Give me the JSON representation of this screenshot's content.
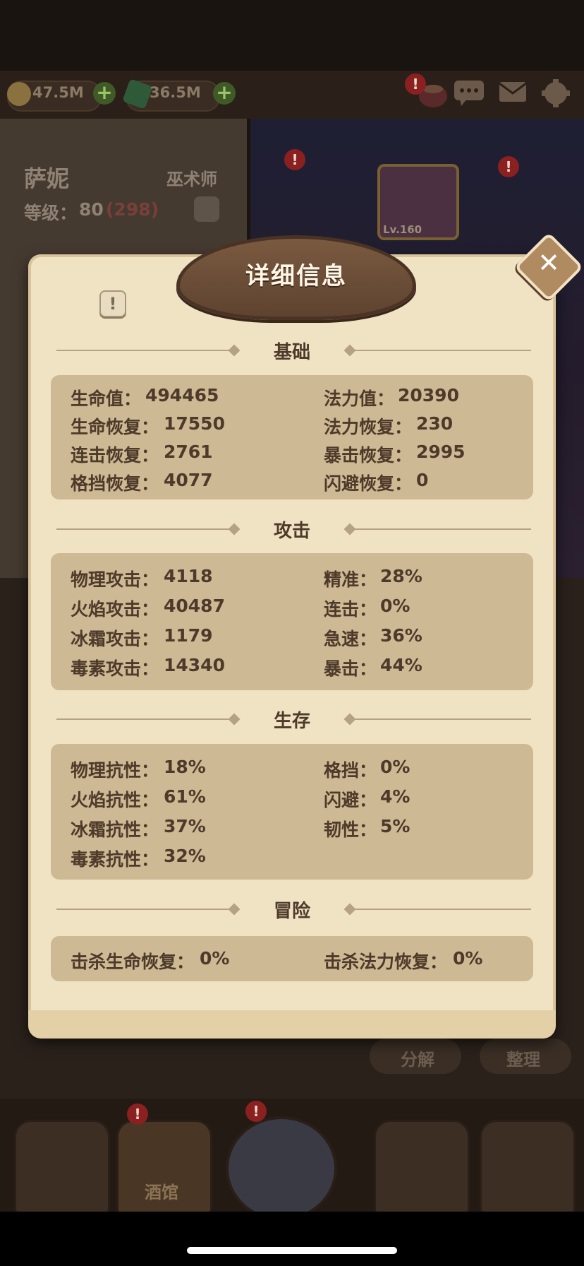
{
  "header": {
    "gold": "47.5M",
    "gems": "36.5M"
  },
  "hero": {
    "name": "萨妮",
    "class": "巫术师",
    "level_label": "等级：",
    "level": "80",
    "level_extra": "(298)",
    "portrait_level": "Lv.160"
  },
  "modal": {
    "title": "详细信息",
    "sections": [
      {
        "title": "基础",
        "stats": [
          {
            "label": "生命值：",
            "value": "494465"
          },
          {
            "label": "法力值：",
            "value": "20390"
          },
          {
            "label": "生命恢复：",
            "value": "17550"
          },
          {
            "label": "法力恢复：",
            "value": "230"
          },
          {
            "label": "连击恢复：",
            "value": "2761"
          },
          {
            "label": "暴击恢复：",
            "value": "2995"
          },
          {
            "label": "格挡恢复：",
            "value": "4077"
          },
          {
            "label": "闪避恢复：",
            "value": "0"
          }
        ]
      },
      {
        "title": "攻击",
        "stats": [
          {
            "label": "物理攻击：",
            "value": "4118"
          },
          {
            "label": "精准：",
            "value": "28%"
          },
          {
            "label": "火焰攻击：",
            "value": "40487"
          },
          {
            "label": "连击：",
            "value": "0%"
          },
          {
            "label": "冰霜攻击：",
            "value": "1179"
          },
          {
            "label": "急速：",
            "value": "36%"
          },
          {
            "label": "毒素攻击：",
            "value": "14340"
          },
          {
            "label": "暴击：",
            "value": "44%"
          }
        ]
      },
      {
        "title": "生存",
        "stats": [
          {
            "label": "物理抗性：",
            "value": "18%"
          },
          {
            "label": "格挡：",
            "value": "0%"
          },
          {
            "label": "火焰抗性：",
            "value": "61%"
          },
          {
            "label": "闪避：",
            "value": "4%"
          },
          {
            "label": "冰霜抗性：",
            "value": "37%"
          },
          {
            "label": "韧性：",
            "value": "5%"
          },
          {
            "label": "毒素抗性：",
            "value": "32%"
          }
        ]
      },
      {
        "title": "冒险",
        "stats": [
          {
            "label": "击杀生命恢复：",
            "value": "0%"
          },
          {
            "label": "击杀法力恢复：",
            "value": "0%"
          }
        ]
      }
    ]
  },
  "inventory": {
    "decompose": "分解",
    "organize": "整理"
  },
  "nav": {
    "tavern": "酒馆"
  },
  "colors": {
    "parchment": "#f0e3c4",
    "section_box": "#cdb993",
    "text": "#4e3a2a",
    "alert": "#8a2020"
  }
}
